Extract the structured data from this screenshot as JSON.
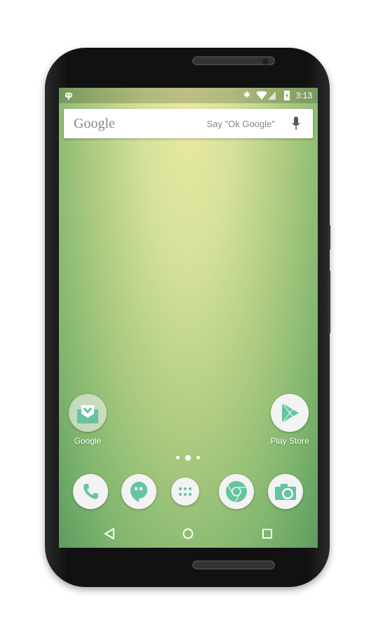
{
  "status_bar": {
    "time": "3:13",
    "icons": [
      "cyanogenmod-icon",
      "bluetooth-icon",
      "wifi-icon",
      "signal-icon",
      "battery-charging-icon"
    ]
  },
  "search": {
    "logo": "Google",
    "hint": "Say \"Ok Google\"",
    "mic": "mic-icon"
  },
  "home": {
    "apps": [
      {
        "label": "Google",
        "icon": "folder-inbox-icon"
      },
      {
        "label": "Play Store",
        "icon": "play-store-icon"
      }
    ]
  },
  "page_indicator": {
    "pages": 3,
    "current": 2
  },
  "dock": [
    {
      "icon": "phone-icon"
    },
    {
      "icon": "hangouts-icon"
    },
    {
      "icon": "app-drawer-icon"
    },
    {
      "icon": "chrome-icon"
    },
    {
      "icon": "camera-icon"
    }
  ],
  "nav": [
    "back-icon",
    "home-icon",
    "recents-icon"
  ],
  "colors": {
    "accent": "#66c4a0",
    "icon_bg": "#f3f3f3"
  }
}
